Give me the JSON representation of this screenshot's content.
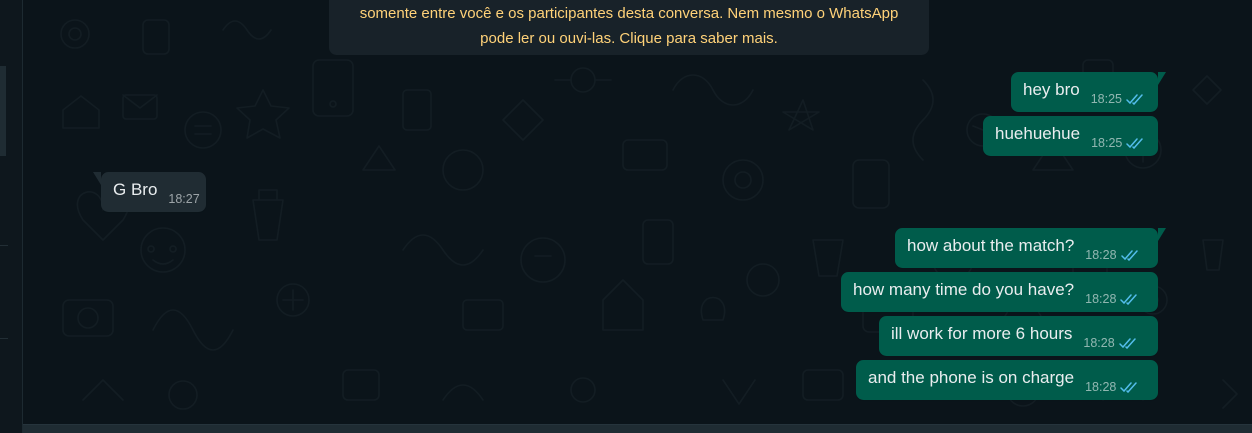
{
  "encryption_notice": {
    "line1": "somente entre você e os participantes desta conversa. Nem mesmo o WhatsApp",
    "line2": "pode ler ou ouvi-las. Clique para saber mais."
  },
  "messages": [
    {
      "text": "hey bro",
      "time": "18:25",
      "direction": "outgoing",
      "status": "read"
    },
    {
      "text": "huehuehue",
      "time": "18:25",
      "direction": "outgoing",
      "status": "read"
    },
    {
      "text": "G Bro",
      "time": "18:27",
      "direction": "incoming"
    },
    {
      "text": "how about the match?",
      "time": "18:28",
      "direction": "outgoing",
      "status": "read"
    },
    {
      "text": "how many time do you have?",
      "time": "18:28",
      "direction": "outgoing",
      "status": "read"
    },
    {
      "text": "ill work for more 6 hours",
      "time": "18:28",
      "direction": "outgoing",
      "status": "read"
    },
    {
      "text": "and the phone is on charge",
      "time": "18:28",
      "direction": "outgoing",
      "status": "read"
    }
  ],
  "colors": {
    "background": "#0b141a",
    "outgoing_bubble": "#005c4b",
    "incoming_bubble": "#202c33",
    "notice_bubble": "#182229",
    "notice_text": "#ffd279",
    "read_ticks": "#53bdeb"
  },
  "icons": [
    "double-check-read-icon"
  ]
}
